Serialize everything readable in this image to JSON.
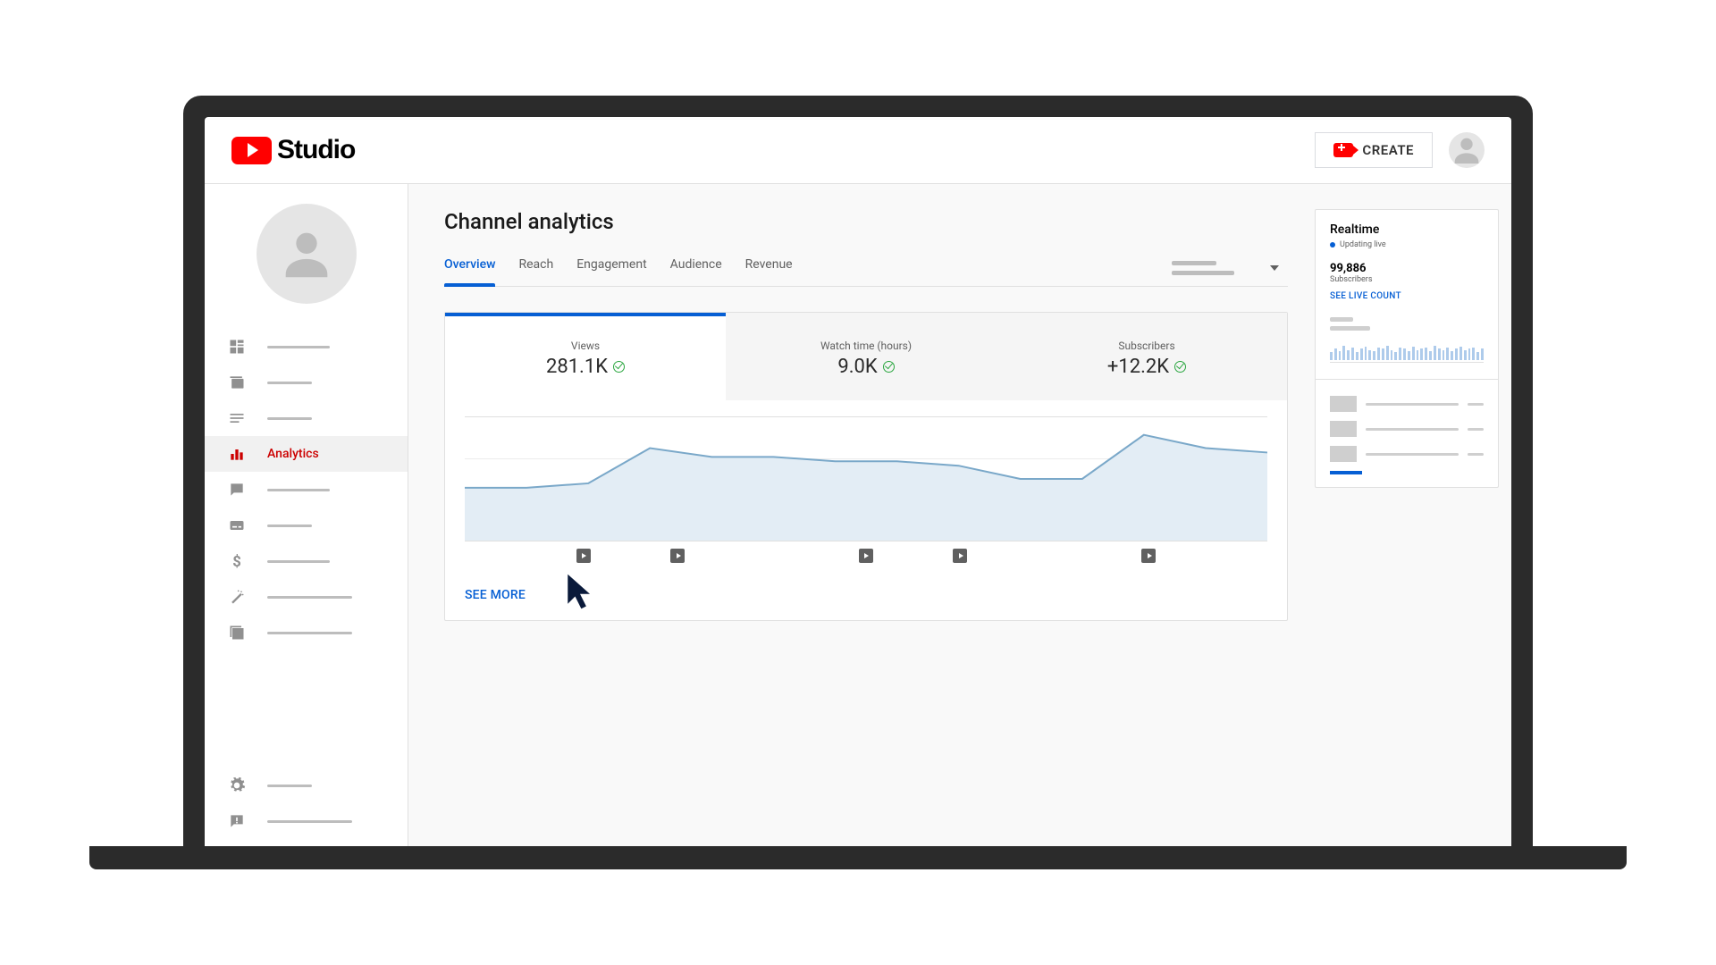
{
  "brand": {
    "name": "Studio"
  },
  "topbar": {
    "create": "CREATE"
  },
  "sidebar": {
    "analytics_label": "Analytics"
  },
  "page": {
    "title": "Channel analytics"
  },
  "tabs": {
    "overview": "Overview",
    "reach": "Reach",
    "engagement": "Engagement",
    "audience": "Audience",
    "revenue": "Revenue"
  },
  "metrics": {
    "views": {
      "label": "Views",
      "value": "281.1K"
    },
    "watch": {
      "label": "Watch time (hours)",
      "value": "9.0K"
    },
    "subs": {
      "label": "Subscribers",
      "value": "+12.2K"
    }
  },
  "card": {
    "see_more": "SEE MORE"
  },
  "realtime": {
    "title": "Realtime",
    "updating": "Updating live",
    "subscribers_value": "99,886",
    "subscribers_label": "Subscribers",
    "see_live": "SEE LIVE COUNT"
  },
  "chart_data": {
    "type": "line",
    "title": "Views",
    "xlabel": "",
    "ylabel": "",
    "x": [
      0,
      1,
      2,
      3,
      4,
      5,
      6,
      7,
      8,
      9,
      10,
      11,
      12,
      13
    ],
    "y": [
      6,
      6,
      6.5,
      10.5,
      9.5,
      9.5,
      9,
      9,
      8.5,
      7,
      7,
      12,
      10.5,
      10
    ],
    "ylim": [
      0,
      14
    ]
  }
}
